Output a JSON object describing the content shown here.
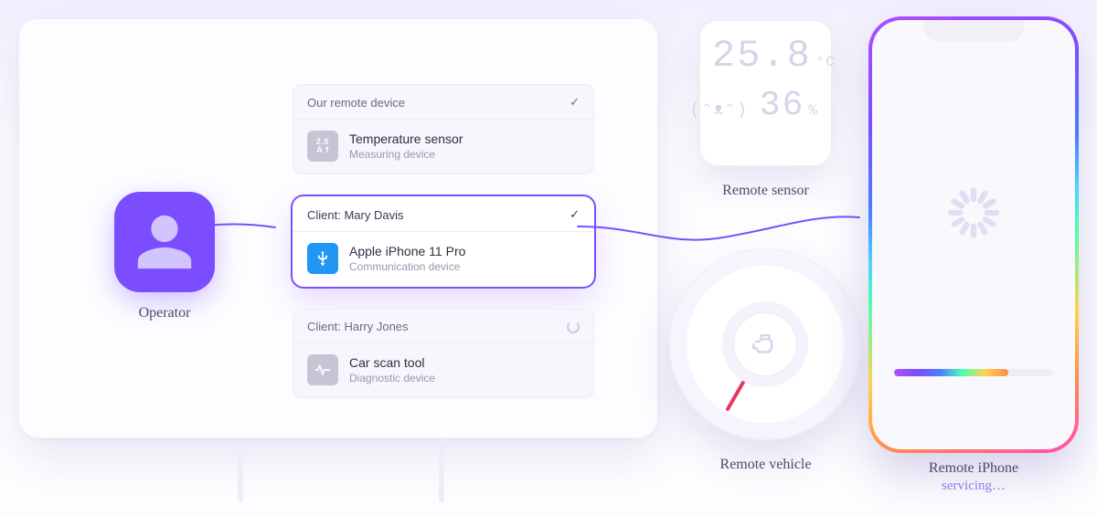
{
  "operator_label": "Operator",
  "cards": [
    {
      "header": "Our remote device",
      "status": "done",
      "title": "Temperature sensor",
      "subtitle": "Measuring device",
      "icon": "temp"
    },
    {
      "header": "Client: Mary Davis",
      "status": "selected",
      "title": "Apple iPhone 11 Pro",
      "subtitle": "Communication device",
      "icon": "usb"
    },
    {
      "header": "Client: Harry Jones",
      "status": "loading",
      "title": "Car scan tool",
      "subtitle": "Diagnostic device",
      "icon": "ecg"
    }
  ],
  "sensor": {
    "temp_value": "25.8",
    "temp_unit": "°C",
    "humidity_value": "36",
    "humidity_unit": "%",
    "label": "Remote sensor"
  },
  "gauge": {
    "label": "Remote vehicle"
  },
  "phone": {
    "label": "Remote iPhone",
    "status": "servicing…",
    "progress_pct": 72
  },
  "colors": {
    "accent": "#7c4dff"
  }
}
